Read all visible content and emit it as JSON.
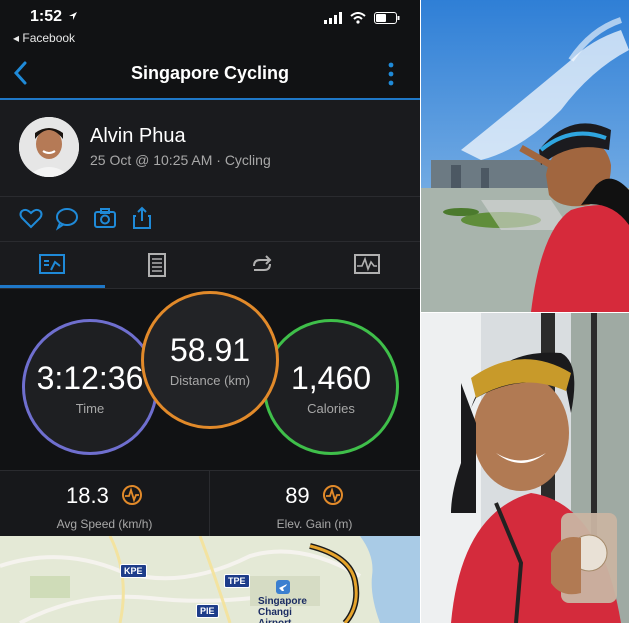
{
  "status_bar": {
    "time": "1:52",
    "back_app": "◂ Facebook"
  },
  "nav": {
    "title": "Singapore Cycling"
  },
  "activity": {
    "athlete_name": "Alvin Phua",
    "meta": "25 Oct @ 10:25 AM · Cycling"
  },
  "stats": {
    "time": {
      "value": "3:12:36",
      "label": "Time"
    },
    "distance": {
      "value": "58.91",
      "label": "Distance (km)"
    },
    "calories": {
      "value": "1,460",
      "label": "Calories"
    }
  },
  "sub_stats": {
    "avg_speed": {
      "value": "18.3",
      "label": "Avg Speed (km/h)"
    },
    "elev_gain": {
      "value": "89",
      "label": "Elev. Gain (m)"
    }
  },
  "map": {
    "labels": [
      "Singapore Changi Airport"
    ],
    "shields": [
      "KPE",
      "TPE",
      "PIE"
    ]
  },
  "colors": {
    "accent_blue": "#1f78c8",
    "time_ring": "#6f6fcf",
    "distance_ring": "#e28a2a",
    "calories_ring": "#3fbf4a",
    "chart_icon_orange": "#e28a2a"
  },
  "icons": [
    "back-chevron-icon",
    "more-vertical-icon",
    "heart-icon",
    "comment-icon",
    "camera-icon",
    "share-icon",
    "summary-tab-icon",
    "details-tab-icon",
    "laps-tab-icon",
    "charts-tab-icon",
    "trend-icon"
  ]
}
